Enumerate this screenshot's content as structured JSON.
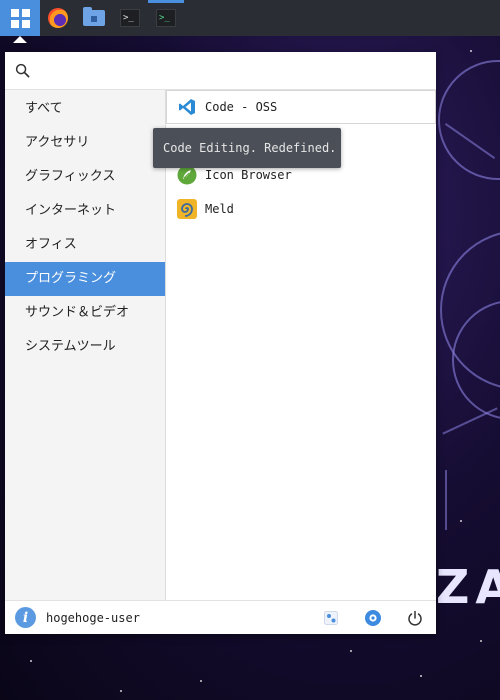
{
  "wallpaper": {
    "text": "ZAVO"
  },
  "taskbar": {
    "menu_icon": "grid-icon",
    "items": [
      {
        "icon": "firefox-icon"
      },
      {
        "icon": "folder-icon"
      },
      {
        "icon": "terminal-icon",
        "glyph": ">_"
      },
      {
        "icon": "terminal-icon",
        "glyph": ">_",
        "active": true
      }
    ]
  },
  "search": {
    "placeholder": "",
    "value": ""
  },
  "categories": [
    {
      "label": "すべて"
    },
    {
      "label": "アクセサリ"
    },
    {
      "label": "グラフィックス"
    },
    {
      "label": "インターネット"
    },
    {
      "label": "オフィス"
    },
    {
      "label": "プログラミング",
      "selected": true
    },
    {
      "label": "サウンド＆ビデオ"
    },
    {
      "label": "システムツール"
    }
  ],
  "apps": [
    {
      "label": "Code - OSS",
      "icon": "vscode-icon"
    },
    {
      "label": "",
      "icon": "hidden-by-tooltip"
    },
    {
      "label": "Icon Browser",
      "icon": "icon-browser-icon"
    },
    {
      "label": "Meld",
      "icon": "meld-icon"
    }
  ],
  "tooltip": {
    "text": "Code Editing. Redefined."
  },
  "footer": {
    "username": "hogehoge-user"
  },
  "colors": {
    "accent": "#4a8fde",
    "taskbar": "#2a2d33",
    "tooltip": "#4b4f57"
  }
}
